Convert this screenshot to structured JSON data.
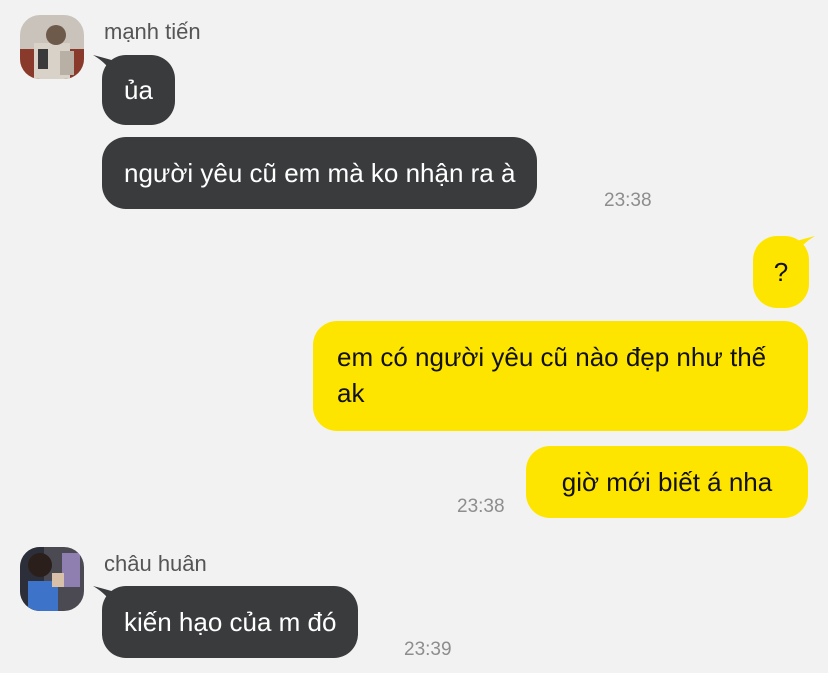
{
  "colors": {
    "background": "#f2f2f2",
    "incoming_bubble": "#3a3b3d",
    "outgoing_bubble": "#fee500",
    "timestamp": "#8d8d8d",
    "sender_name": "#555555"
  },
  "conversation": {
    "group1": {
      "sender": "mạnh tiến",
      "messages": [
        "ủa",
        "người yêu cũ em mà ko nhận ra à"
      ],
      "time": "23:38"
    },
    "group2": {
      "messages": [
        "?",
        "em có người yêu cũ nào đẹp như thế ak",
        "giờ mới biết á nha"
      ],
      "time": "23:38"
    },
    "group3": {
      "sender": "châu huân",
      "messages": [
        "kiến hạo của m đó"
      ],
      "time": "23:39"
    }
  }
}
